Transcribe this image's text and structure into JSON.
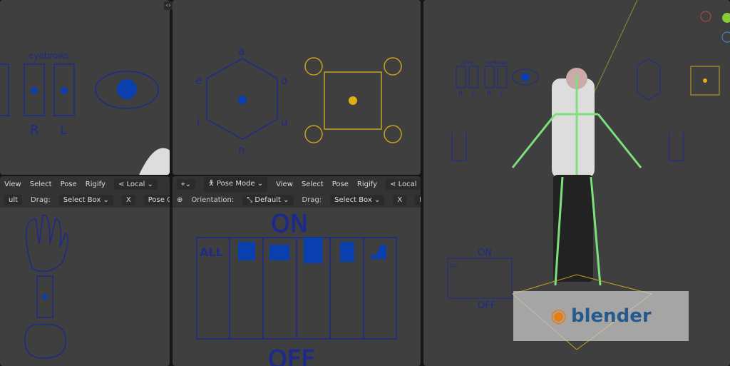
{
  "top_left": {
    "eyebrows_label": "eyebrows",
    "r": "R",
    "l": "L"
  },
  "top_middle": {
    "vowels": {
      "a": "a",
      "e": "e",
      "o": "o",
      "i": "i",
      "u": "u",
      "n": "n"
    }
  },
  "bottom_left_header": {
    "view": "View",
    "select": "Select",
    "pose": "Pose",
    "rigify": "Rigify",
    "pivot": "Local",
    "orient_partial": "ult",
    "drag_label": "Drag:",
    "drag_value": "Select Box",
    "x_label": "X",
    "pose_options": "Pose Op"
  },
  "bottom_middle_header": {
    "mode": "Pose Mode",
    "view": "View",
    "select": "Select",
    "pose": "Pose",
    "rigify": "Rigify",
    "pivot": "Local",
    "orientation_label": "Orientation:",
    "orientation_value": "Default",
    "drag_label": "Drag:",
    "drag_value": "Select Box",
    "x_label": "X",
    "pose_partial": "Po"
  },
  "bottom_middle": {
    "on": "ON",
    "off": "OFF",
    "all": "ALL"
  },
  "right": {
    "blink": "blink",
    "eyebrow": "eyebrow",
    "r": "R",
    "l": "L",
    "on": "ON",
    "off": "OFF",
    "all": "ALL",
    "logo": "blender"
  },
  "colors": {
    "blue": "#1d2a8a",
    "dot": "#0a3fb0",
    "yellow": "#c8a020",
    "green": "#7de07d"
  }
}
